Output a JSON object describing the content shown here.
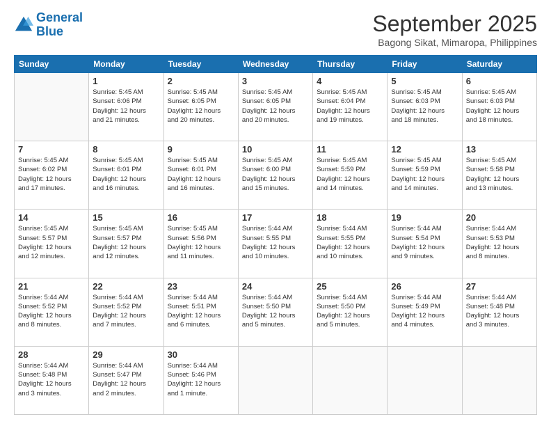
{
  "logo": {
    "line1": "General",
    "line2": "Blue"
  },
  "title": "September 2025",
  "subtitle": "Bagong Sikat, Mimaropa, Philippines",
  "days_of_week": [
    "Sunday",
    "Monday",
    "Tuesday",
    "Wednesday",
    "Thursday",
    "Friday",
    "Saturday"
  ],
  "weeks": [
    [
      {
        "day": "",
        "info": ""
      },
      {
        "day": "1",
        "info": "Sunrise: 5:45 AM\nSunset: 6:06 PM\nDaylight: 12 hours\nand 21 minutes."
      },
      {
        "day": "2",
        "info": "Sunrise: 5:45 AM\nSunset: 6:05 PM\nDaylight: 12 hours\nand 20 minutes."
      },
      {
        "day": "3",
        "info": "Sunrise: 5:45 AM\nSunset: 6:05 PM\nDaylight: 12 hours\nand 20 minutes."
      },
      {
        "day": "4",
        "info": "Sunrise: 5:45 AM\nSunset: 6:04 PM\nDaylight: 12 hours\nand 19 minutes."
      },
      {
        "day": "5",
        "info": "Sunrise: 5:45 AM\nSunset: 6:03 PM\nDaylight: 12 hours\nand 18 minutes."
      },
      {
        "day": "6",
        "info": "Sunrise: 5:45 AM\nSunset: 6:03 PM\nDaylight: 12 hours\nand 18 minutes."
      }
    ],
    [
      {
        "day": "7",
        "info": "Sunrise: 5:45 AM\nSunset: 6:02 PM\nDaylight: 12 hours\nand 17 minutes."
      },
      {
        "day": "8",
        "info": "Sunrise: 5:45 AM\nSunset: 6:01 PM\nDaylight: 12 hours\nand 16 minutes."
      },
      {
        "day": "9",
        "info": "Sunrise: 5:45 AM\nSunset: 6:01 PM\nDaylight: 12 hours\nand 16 minutes."
      },
      {
        "day": "10",
        "info": "Sunrise: 5:45 AM\nSunset: 6:00 PM\nDaylight: 12 hours\nand 15 minutes."
      },
      {
        "day": "11",
        "info": "Sunrise: 5:45 AM\nSunset: 5:59 PM\nDaylight: 12 hours\nand 14 minutes."
      },
      {
        "day": "12",
        "info": "Sunrise: 5:45 AM\nSunset: 5:59 PM\nDaylight: 12 hours\nand 14 minutes."
      },
      {
        "day": "13",
        "info": "Sunrise: 5:45 AM\nSunset: 5:58 PM\nDaylight: 12 hours\nand 13 minutes."
      }
    ],
    [
      {
        "day": "14",
        "info": "Sunrise: 5:45 AM\nSunset: 5:57 PM\nDaylight: 12 hours\nand 12 minutes."
      },
      {
        "day": "15",
        "info": "Sunrise: 5:45 AM\nSunset: 5:57 PM\nDaylight: 12 hours\nand 12 minutes."
      },
      {
        "day": "16",
        "info": "Sunrise: 5:45 AM\nSunset: 5:56 PM\nDaylight: 12 hours\nand 11 minutes."
      },
      {
        "day": "17",
        "info": "Sunrise: 5:44 AM\nSunset: 5:55 PM\nDaylight: 12 hours\nand 10 minutes."
      },
      {
        "day": "18",
        "info": "Sunrise: 5:44 AM\nSunset: 5:55 PM\nDaylight: 12 hours\nand 10 minutes."
      },
      {
        "day": "19",
        "info": "Sunrise: 5:44 AM\nSunset: 5:54 PM\nDaylight: 12 hours\nand 9 minutes."
      },
      {
        "day": "20",
        "info": "Sunrise: 5:44 AM\nSunset: 5:53 PM\nDaylight: 12 hours\nand 8 minutes."
      }
    ],
    [
      {
        "day": "21",
        "info": "Sunrise: 5:44 AM\nSunset: 5:52 PM\nDaylight: 12 hours\nand 8 minutes."
      },
      {
        "day": "22",
        "info": "Sunrise: 5:44 AM\nSunset: 5:52 PM\nDaylight: 12 hours\nand 7 minutes."
      },
      {
        "day": "23",
        "info": "Sunrise: 5:44 AM\nSunset: 5:51 PM\nDaylight: 12 hours\nand 6 minutes."
      },
      {
        "day": "24",
        "info": "Sunrise: 5:44 AM\nSunset: 5:50 PM\nDaylight: 12 hours\nand 5 minutes."
      },
      {
        "day": "25",
        "info": "Sunrise: 5:44 AM\nSunset: 5:50 PM\nDaylight: 12 hours\nand 5 minutes."
      },
      {
        "day": "26",
        "info": "Sunrise: 5:44 AM\nSunset: 5:49 PM\nDaylight: 12 hours\nand 4 minutes."
      },
      {
        "day": "27",
        "info": "Sunrise: 5:44 AM\nSunset: 5:48 PM\nDaylight: 12 hours\nand 3 minutes."
      }
    ],
    [
      {
        "day": "28",
        "info": "Sunrise: 5:44 AM\nSunset: 5:48 PM\nDaylight: 12 hours\nand 3 minutes."
      },
      {
        "day": "29",
        "info": "Sunrise: 5:44 AM\nSunset: 5:47 PM\nDaylight: 12 hours\nand 2 minutes."
      },
      {
        "day": "30",
        "info": "Sunrise: 5:44 AM\nSunset: 5:46 PM\nDaylight: 12 hours\nand 1 minute."
      },
      {
        "day": "",
        "info": ""
      },
      {
        "day": "",
        "info": ""
      },
      {
        "day": "",
        "info": ""
      },
      {
        "day": "",
        "info": ""
      }
    ]
  ]
}
